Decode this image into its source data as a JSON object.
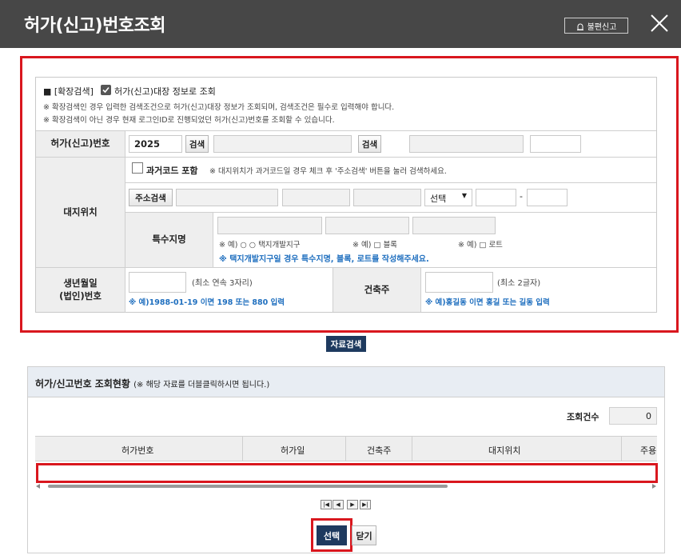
{
  "header": {
    "title": "허가(신고)번호조회",
    "report_label": "불편신고"
  },
  "form": {
    "extended_search_label": "■ [확장검색]",
    "ledger_checkbox_label": "허가(신고)대장 정보로 조회",
    "notice_1": "※ 확장검색인 경우 입력한 검색조건으로 허가(신고)대장 정보가 조회되며, 검색조건은 필수로 입력해야 합니다.",
    "notice_2": "※ 확장검색이 아닌 경우 현재 로그인ID로 진행되었던 허가(신고)번호를 조회할 수 있습니다.",
    "permit_no": {
      "label": "허가(신고)번호",
      "year_value": "2025",
      "search_label": "검색",
      "search2_label": "검색"
    },
    "site": {
      "label": "대지위치",
      "past_code_label": "과거코드 포함",
      "past_code_note": "※ 대지위치가 과거코드일 경우 체크 후 '주소검색' 버튼을 눌러 검색하세요.",
      "address_search_label": "주소검색",
      "select_value": "선택",
      "dash": "-",
      "special_label": "특수지명",
      "ex_1": "※ 예) ○ ○ 택지개발지구",
      "ex_2": "※ 예) □ 블록",
      "ex_3": "※ 예) □ 로트",
      "special_note": "※ 택지개발지구일 경우 특수지명, 블록, 로트를 작성해주세요."
    },
    "birth": {
      "label_1": "생년월일",
      "label_2": "(법인)번호",
      "hint": "(최소 연속 3자리)",
      "example": "※ 예)1988-01-19 이면 198 또는 880 입력"
    },
    "owner": {
      "label": "건축주",
      "hint": "(최소 2글자)",
      "example": "※ 예)홍길동 이면 홍길 또는 길동 입력"
    }
  },
  "search_button_label": "자료검색",
  "results": {
    "title": "허가/신고번호 조회현황",
    "subtitle": "(※ 해당 자료를 더블클릭하시면 됩니다.)",
    "count_label": "조회건수",
    "count_value": "0",
    "columns": [
      "허가번호",
      "허가일",
      "건축주",
      "대지위치",
      "주용"
    ]
  },
  "pager": [
    "|◀",
    "◀",
    "▶",
    "▶|"
  ],
  "buttons": {
    "select": "선택",
    "close": "닫기"
  },
  "colors": {
    "header_bg": "#474747",
    "highlight_red": "#d9171e",
    "navy_button": "#1e3a5f",
    "note_blue": "#1f6fbf"
  }
}
